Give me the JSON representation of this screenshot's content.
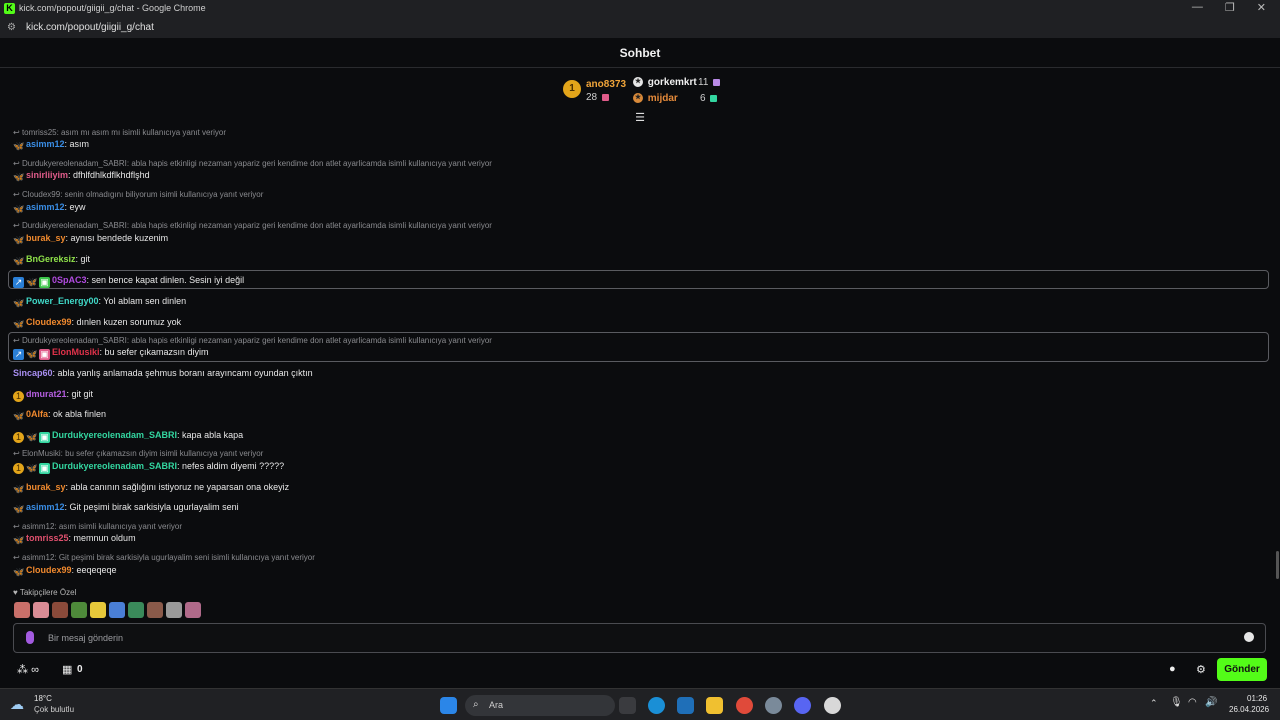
{
  "window": {
    "title": "kick.com/popout/giigii_g/chat - Google Chrome",
    "url": "kick.com/popout/giigii_g/chat",
    "favicon": "K"
  },
  "chat_title": "Sohbet",
  "leaderboard": {
    "first": {
      "rank": "1",
      "name": "ano8373",
      "count": "28"
    },
    "second": {
      "name": "gorkemkrt",
      "count": "11"
    },
    "third": {
      "name": "mijdar",
      "count": "6"
    }
  },
  "messages": [
    {
      "reply": "tomriss25: asım mı asım mı isimli kullanıcıya yanıt veriyor",
      "user": "asimm12",
      "text": ": asım"
    },
    {
      "reply": "Durdukyereolenadam_SABRI: abla hapis etkinligi nezaman yapariz geri kendime don atlet ayarlicamda isimli kullanıcıya yanıt veriyor",
      "user": "sinirliiyim",
      "text": ": dfhlfdhlkdflkhdflşhd"
    },
    {
      "reply": "Cloudex99: senin olmadıgını biliyorum isimli kullanıcıya yanıt veriyor",
      "user": "asimm12",
      "text": ": eyw"
    },
    {
      "reply": "Durdukyereolenadam_SABRI: abla hapis etkinligi nezaman yapariz geri kendime don atlet ayarlicamda isimli kullanıcıya yanıt veriyor",
      "user": "burak_sy",
      "text": ": aynısı bendede kuzenim"
    },
    {
      "user": "BnGereksiz",
      "text": ": git"
    },
    {
      "user": "0SpAC3",
      "text": ": sen bence kapat dinlen. Sesin iyi değil"
    },
    {
      "user": "Power_Energy00",
      "text": ": Yol ablam sen dinlen"
    },
    {
      "user": "Cloudex99",
      "text": ": dınlen kuzen sorumuz yok"
    },
    {
      "reply": "Durdukyereolenadam_SABRI: abla hapis etkinligi nezaman yapariz geri kendime don atlet ayarlicamda isimli kullanıcıya yanıt veriyor",
      "user": "ElonMusiki",
      "text": ": bu sefer çıkamazsın diyim"
    },
    {
      "user": "Sincap60",
      "text": ": abla yanlış anlamada şehmus boranı arayıncamı oyundan çıktın"
    },
    {
      "user": "dmurat21",
      "text": ": git git"
    },
    {
      "user": "0Alfa",
      "text": ": ok abla finlen"
    },
    {
      "user": "Durdukyereolenadam_SABRI",
      "text": ": kapa abla kapa"
    },
    {
      "reply": "ElonMusiki: bu sefer çıkamazsın diyim isimli kullanıcıya yanıt veriyor",
      "user": "Durdukyereolenadam_SABRI",
      "text": ": nefes aldim diyemi ?????"
    },
    {
      "user": "burak_sy",
      "text": ": abla canının sağlığını istiyoruz ne yaparsan ona okeyiz"
    },
    {
      "user": "asimm12",
      "text": ": Git peşimi birak sarkisiyla ugurlayalim seni"
    },
    {
      "reply": "asimm12: asım isimli kullanıcıya yanıt veriyor",
      "user": "tomriss25",
      "text": ": memnun oldum"
    },
    {
      "reply": "asimm12: Git peşimi birak sarkisiyla ugurlayalim seni isimli kullanıcıya yanıt veriyor",
      "user": "Cloudex99",
      "text": ": eeqeqeqe"
    }
  ],
  "colors": {
    "accent": "#53fc18",
    "u_asimm12": "#3a8ee6",
    "u_sinirliiyim": "#e05c8a",
    "u_burak_sy": "#f08a2e",
    "u_BnGereksiz": "#8fe24a",
    "u_0SpAC3": "#b14be0",
    "u_Power_Energy00": "#40d9c8",
    "u_Cloudex99": "#f0892e",
    "u_ElonMusiki": "#e0324a",
    "u_Sincap60": "#a88ef0",
    "u_dmurat21": "#b55ee0",
    "u_0Alfa": "#f0892e",
    "u_Durdukyere": "#33d6a0",
    "u_tomriss25": "#e0506e"
  },
  "emote_section": {
    "label": "Takipçilere Özel"
  },
  "input": {
    "placeholder": "Bir mesaj gönderin"
  },
  "toolbar": {
    "points": "∞",
    "store_count": "0",
    "send_label": "Gönder"
  },
  "taskbar": {
    "weather_temp": "18°C",
    "weather_desc": "Çok bulutlu",
    "search_placeholder": "Ara",
    "time": "01:26",
    "date": "26.04.2026"
  }
}
